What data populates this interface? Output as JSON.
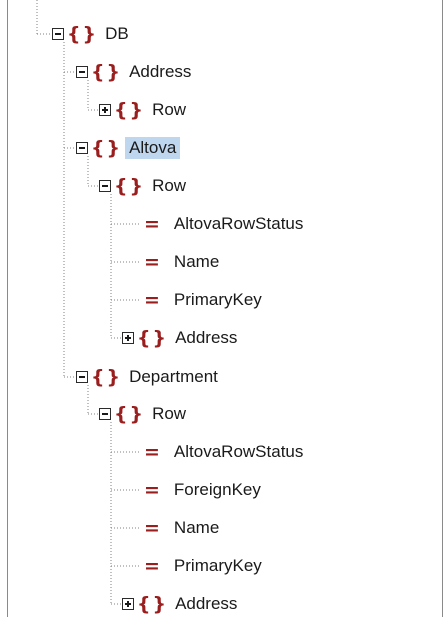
{
  "tree": {
    "db": "DB",
    "address": "Address",
    "address_row": "Row",
    "altova": "Altova",
    "altova_row": "Row",
    "altova_row_status": "AltovaRowStatus",
    "altova_name": "Name",
    "altova_primary_key": "PrimaryKey",
    "altova_address": "Address",
    "department": "Department",
    "department_row": "Row",
    "department_row_status": "AltovaRowStatus",
    "department_foreign_key": "ForeignKey",
    "department_name": "Name",
    "department_primary_key": "PrimaryKey",
    "department_address": "Address"
  },
  "colors": {
    "element_icon": "#9a1e1e",
    "selection": "#bfd7ee"
  },
  "icons": {
    "element": "curly-braces-icon",
    "attribute": "equals-icon",
    "collapse": "minus-box-icon",
    "expand": "plus-box-icon"
  }
}
